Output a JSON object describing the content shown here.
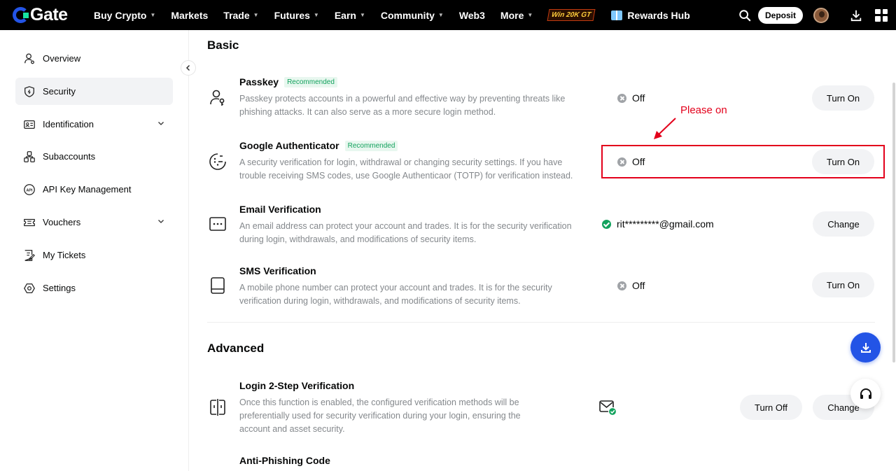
{
  "header": {
    "logo_text": "Gate",
    "nav": [
      {
        "label": "Buy Crypto",
        "has_caret": true
      },
      {
        "label": "Markets",
        "has_caret": false
      },
      {
        "label": "Trade",
        "has_caret": true
      },
      {
        "label": "Futures",
        "has_caret": true
      },
      {
        "label": "Earn",
        "has_caret": true
      },
      {
        "label": "Community",
        "has_caret": true
      },
      {
        "label": "Web3",
        "has_caret": false
      },
      {
        "label": "More",
        "has_caret": true
      }
    ],
    "promo_label": "Win 20K GT",
    "rewards_label": "Rewards Hub",
    "deposit_label": "Deposit"
  },
  "sidebar": {
    "items": [
      {
        "label": "Overview",
        "icon": "user-icon",
        "active": false,
        "expandable": false
      },
      {
        "label": "Security",
        "icon": "shield-icon",
        "active": true,
        "expandable": false
      },
      {
        "label": "Identification",
        "icon": "id-card-icon",
        "active": false,
        "expandable": true
      },
      {
        "label": "Subaccounts",
        "icon": "subaccounts-icon",
        "active": false,
        "expandable": false
      },
      {
        "label": "API Key Management",
        "icon": "api-icon",
        "active": false,
        "expandable": false
      },
      {
        "label": "Vouchers",
        "icon": "voucher-icon",
        "active": false,
        "expandable": true
      },
      {
        "label": "My Tickets",
        "icon": "ticket-icon",
        "active": false,
        "expandable": false
      },
      {
        "label": "Settings",
        "icon": "settings-icon",
        "active": false,
        "expandable": false
      }
    ]
  },
  "main": {
    "basic_title": "Basic",
    "advanced_title": "Advanced",
    "basic_rows": [
      {
        "title": "Passkey",
        "badge": "Recommended",
        "desc": "Passkey protects accounts in a powerful and effective way by preventing threats like phishing attacks. It can also serve as a more secure login method.",
        "status": "Off",
        "status_type": "off",
        "button": "Turn On",
        "icon": "passkey-icon"
      },
      {
        "title": "Google Authenticator",
        "badge": "Recommended",
        "desc": "A security verification for login, withdrawal or changing security settings. If you have trouble receiving SMS codes, use Google Authenticaor (TOTP) for verification instead.",
        "status": "Off",
        "status_type": "off",
        "button": "Turn On",
        "icon": "authenticator-icon"
      },
      {
        "title": "Email Verification",
        "badge": "",
        "desc": "An email address can protect your account and trades. It is for the security verification during login, withdrawals, and modifications of security items.",
        "status": "rit*********@gmail.com",
        "status_type": "on",
        "button": "Change",
        "icon": "email-icon"
      },
      {
        "title": "SMS Verification",
        "badge": "",
        "desc": "A mobile phone number can protect your account and trades. It is for the security verification during login, withdrawals, and modifications of security items.",
        "status": "Off",
        "status_type": "off",
        "button": "Turn On",
        "icon": "phone-icon"
      }
    ],
    "advanced_rows": [
      {
        "title": "Login 2-Step Verification",
        "desc": "Once this function is enabled, the configured verification methods will be preferentially used for security verification during your login, ensuring the account and asset security.",
        "button_off": "Turn Off",
        "button_change": "Change",
        "icon": "two-step-icon"
      },
      {
        "title": "Anti-Phishing Code"
      }
    ]
  },
  "annotation": {
    "text": "Please on",
    "color": "#e3001b"
  },
  "colors": {
    "brand_blue": "#2354e6",
    "success_green": "#12a25d"
  }
}
